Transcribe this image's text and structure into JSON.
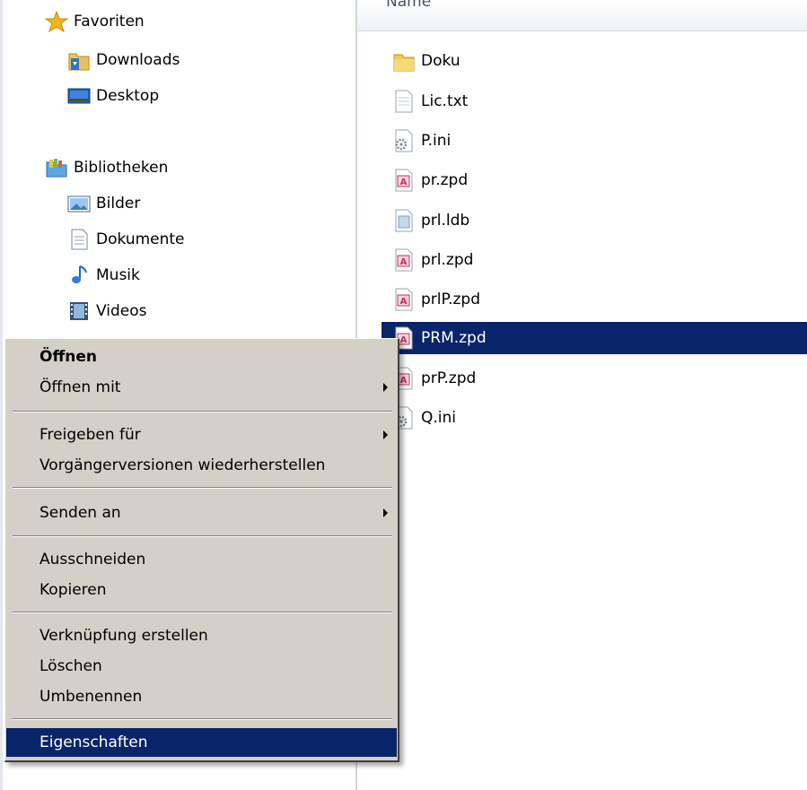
{
  "nav": {
    "favorites": "Favoriten",
    "downloads": "Downloads",
    "desktop": "Desktop",
    "libraries": "Bibliotheken",
    "pictures": "Bilder",
    "documents": "Dokumente",
    "music": "Musik",
    "videos": "Videos"
  },
  "header": {
    "name": "Name"
  },
  "files": [
    {
      "name": "Doku",
      "icon": "folder-icon"
    },
    {
      "name": "Lic.txt",
      "icon": "text-file-icon"
    },
    {
      "name": "P.ini",
      "icon": "settings-file-icon"
    },
    {
      "name": "pr.zpd",
      "icon": "zpd-file-icon"
    },
    {
      "name": "prl.ldb",
      "icon": "ldb-file-icon"
    },
    {
      "name": "prl.zpd",
      "icon": "zpd-file-icon"
    },
    {
      "name": "prlP.zpd",
      "icon": "zpd-file-icon"
    },
    {
      "name": "PRM.zpd",
      "icon": "zpd-file-icon",
      "selected": true
    },
    {
      "name": "prP.zpd",
      "icon": "zpd-file-icon"
    },
    {
      "name": "Q.ini",
      "icon": "settings-file-icon"
    }
  ],
  "menu": {
    "open": "Öffnen",
    "open_with": "Öffnen mit",
    "share_with": "Freigeben für",
    "restore_previous": "Vorgängerversionen wiederherstellen",
    "send_to": "Senden an",
    "cut": "Ausschneiden",
    "copy": "Kopieren",
    "create_shortcut": "Verknüpfung erstellen",
    "delete": "Löschen",
    "rename": "Umbenennen",
    "properties": "Eigenschaften"
  },
  "colors": {
    "selection": "#0a246a",
    "menu_background": "#d4d0c8"
  }
}
